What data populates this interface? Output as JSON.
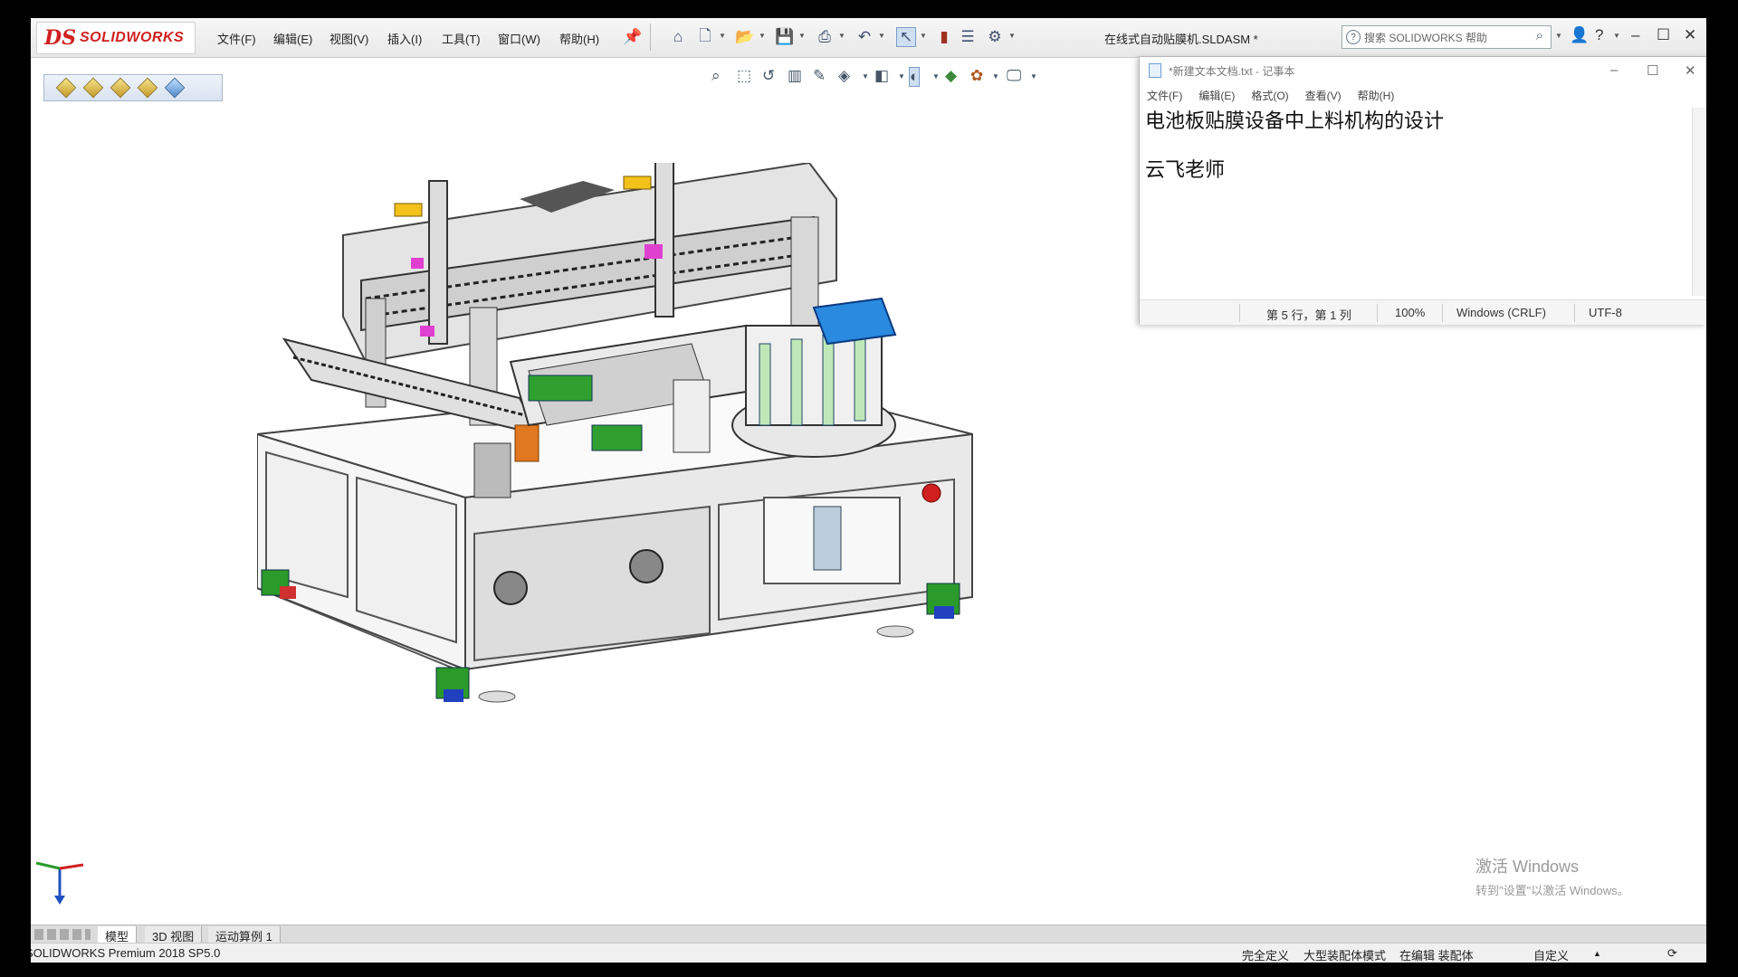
{
  "app": {
    "logo_ds": "DS",
    "logo_text": "SOLIDWORKS",
    "document_title": "在线式自动贴膜机.SLDASM *",
    "search_placeholder": "搜索 SOLIDWORKS 帮助"
  },
  "menu": [
    "文件(F)",
    "编辑(E)",
    "视图(V)",
    "插入(I)",
    "工具(T)",
    "窗口(W)",
    "帮助(H)"
  ],
  "notepad": {
    "title": "*新建文本文档.txt - 记事本",
    "menu": [
      "文件(F)",
      "编辑(E)",
      "格式(O)",
      "查看(V)",
      "帮助(H)"
    ],
    "lines": [
      "电池板贴膜设备中上料机构的设计",
      "",
      "云飞老师"
    ],
    "status": {
      "position": "第 5 行，第 1 列",
      "zoom": "100%",
      "line_ending": "Windows (CRLF)",
      "encoding": "UTF-8"
    }
  },
  "tabs": [
    "模型",
    "3D 视图",
    "运动算例 1"
  ],
  "statusbar": {
    "product": "SOLIDWORKS Premium 2018 SP5.0",
    "state": "完全定义",
    "mode": "大型装配体模式",
    "editing": "在编辑 装配体",
    "custom": "自定义"
  },
  "watermark": {
    "line1": "激活 Windows",
    "line2": "转到\"设置\"以激活 Windows。"
  }
}
